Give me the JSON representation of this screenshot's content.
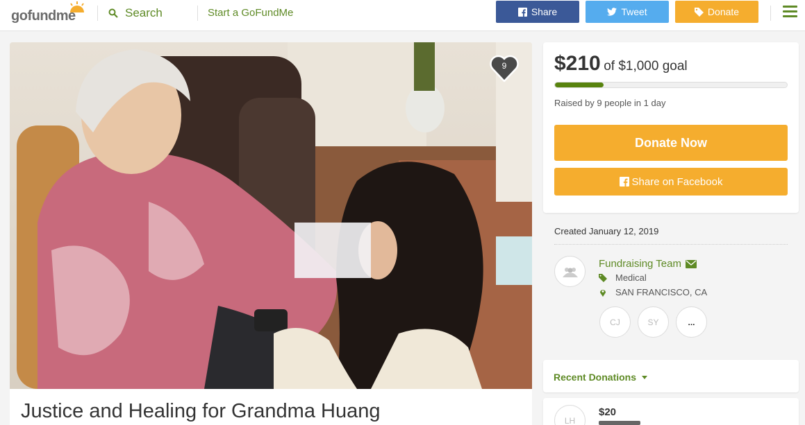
{
  "header": {
    "logo_go": "go",
    "logo_fund": "fund",
    "logo_me": "me",
    "search_label": "Search",
    "start_label": "Start a GoFundMe",
    "share_label": "Share",
    "tweet_label": "Tweet",
    "donate_label": "Donate",
    "icons": {
      "search": "search-icon",
      "facebook": "facebook-icon",
      "twitter": "twitter-icon",
      "donate": "tag-icon",
      "menu": "hamburger-menu-icon"
    }
  },
  "campaign": {
    "title": "Justice and Healing for Grandma Huang",
    "heart_count": "9",
    "raised": "$210",
    "goal_text": "of $1,000 goal",
    "progress_fraction": 0.21,
    "raised_by": "Raised by 9 people in 1 day",
    "donate_now": "Donate Now",
    "share_facebook": "Share on Facebook",
    "created": "Created January 12, 2019",
    "team_name": "Fundraising Team",
    "category": "Medical",
    "location": "SAN FRANCISCO, CA",
    "members": [
      "CJ",
      "SY",
      "..."
    ]
  },
  "recent": {
    "title": "Recent Donations",
    "donations": [
      {
        "initials": "LH",
        "amount": "$20"
      }
    ]
  },
  "colors": {
    "brand_green": "#5e8a25",
    "donate_orange": "#f5ad2e",
    "facebook_blue": "#3b5998",
    "twitter_blue": "#55acee"
  }
}
